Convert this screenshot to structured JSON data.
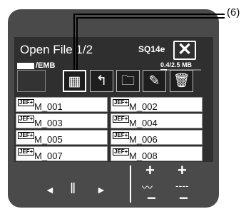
{
  "header": {
    "title": "Open File   1/2",
    "model": "SQ14e",
    "close_glyph": "✕"
  },
  "location": {
    "folder": "/EMB",
    "storage": "0.4/2.5 MB",
    "used_fraction": 0.16
  },
  "toolbar": {
    "icons": [
      "embroidery-icon",
      "thumbnail-list-icon",
      "up-folder-icon",
      "new-folder-icon",
      "rename-pencil-icon",
      "delete-trash-icon"
    ],
    "glyphs": [
      "",
      "▦",
      "↰",
      "🗀",
      "✎",
      "🗑"
    ]
  },
  "files": [
    {
      "tag": "JEF+",
      "name": "M_001"
    },
    {
      "tag": "JEF+",
      "name": "M_002"
    },
    {
      "tag": "JEF+",
      "name": "M_003"
    },
    {
      "tag": "JEF+",
      "name": "M_004"
    },
    {
      "tag": "JEF+",
      "name": "M_005"
    },
    {
      "tag": "JEF+",
      "name": "M_006"
    },
    {
      "tag": "JEF+",
      "name": "M_007"
    },
    {
      "tag": "JEF+",
      "name": "M_008"
    }
  ],
  "controls": {
    "prev": "◄",
    "pause": "‖",
    "next": "►",
    "plus": "+",
    "minus": "−",
    "wave": "〰",
    "dashes": "----"
  },
  "callout": {
    "label": "(6)"
  },
  "colors": {
    "body": "#4a4a4a",
    "screen": "#2f2f2f"
  }
}
